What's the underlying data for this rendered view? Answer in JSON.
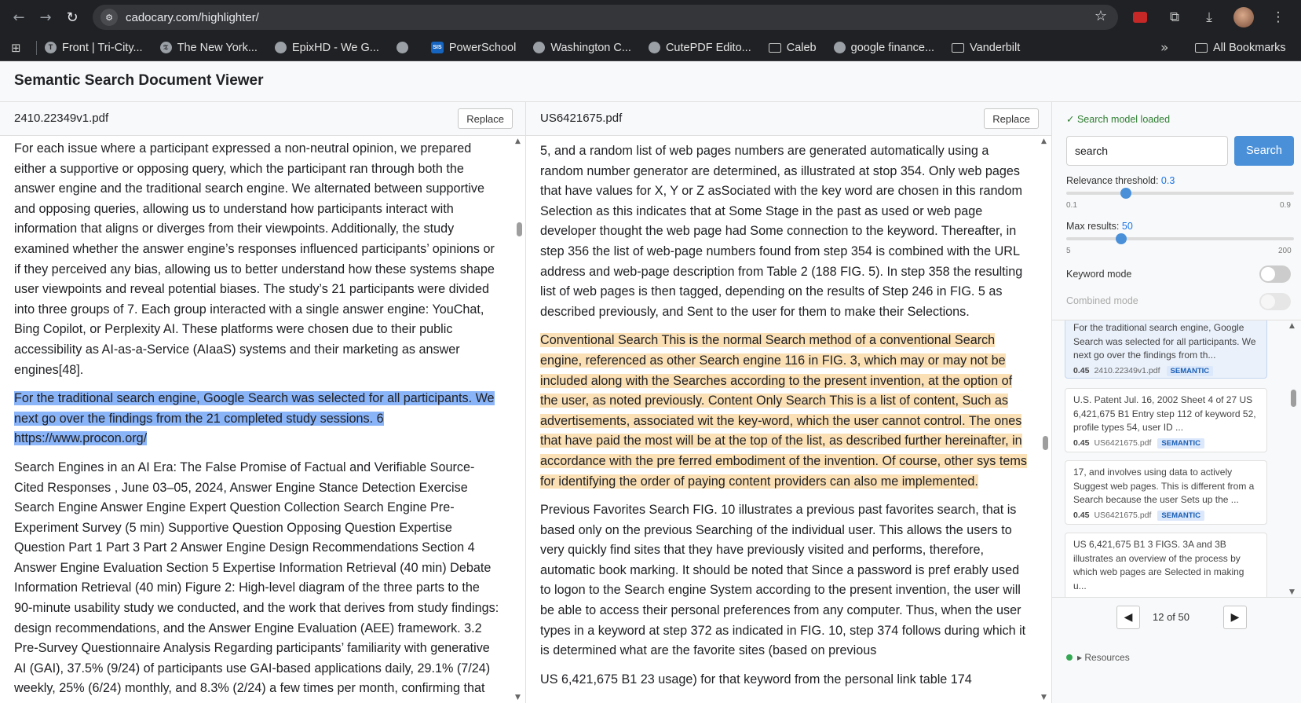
{
  "browser": {
    "url": "cadocary.com/highlighter/",
    "bookmarks": [
      {
        "label": "Front | Tri-City...",
        "icon": "T"
      },
      {
        "label": "The New York...",
        "icon": "NYT"
      },
      {
        "label": "EpixHD - We G...",
        "icon": "globe"
      },
      {
        "label": "",
        "icon": "globe"
      },
      {
        "label": "PowerSchool",
        "icon": "sis"
      },
      {
        "label": "Washington C...",
        "icon": "globe"
      },
      {
        "label": "CutePDF Edito...",
        "icon": "globe"
      },
      {
        "label": "Caleb",
        "icon": "folder"
      },
      {
        "label": "google finance...",
        "icon": "globe"
      },
      {
        "label": "Vanderbilt",
        "icon": "folder"
      }
    ],
    "more_label": "»",
    "all_bookmarks": "All Bookmarks"
  },
  "app": {
    "title": "Semantic Search Document Viewer"
  },
  "left_pane": {
    "filename": "2410.22349v1.pdf",
    "replace_label": "Replace",
    "paragraphs": [
      "For each issue where a participant expressed a non-neutral opinion, we prepared either a supportive or opposing query, which the participant ran through both the answer engine and the traditional search engine. We alternated between supportive and opposing queries, allowing us to understand how participants interact with information that aligns or diverges from their viewpoints. Additionally, the study examined whether the answer engine’s responses influenced participants’ opinions or if they perceived any bias, allowing us to better understand how these systems shape user viewpoints and reveal potential biases. The study’s 21 participants were divided into three groups of 7. Each group interacted with a single answer engine: YouChat, Bing Copilot, or Perplexity AI. These platforms were chosen due to their public accessibility as AI-as-a-Service (AIaaS) systems and their marketing as answer engines[48].",
      " For the traditional search engine, Google Search was selected for all participants. We next go over the findings from the 21 completed study sessions.  6  https://www.procon.org/ ",
      "Search Engines in an AI Era: The False Promise of Factual and Verifiable Source-Cited Responses   , June 03–05, 2024, Answer Engine  Stance Detection Exercise  Search Engine  Answer Engine  Expert Question Collection  Search Engine  Pre-Experiment Survey  (5 min)  Supportive Question Opposing Question Expertise Question  Part 1  Part 3 Part 2  Answer Engine Design Recommendations  Section 4  Answer Engine Evaluation  Section 5  Expertise Information Retrieval  (40 min)  Debate Information Retrieval  (40 min)  Figure 2: High-level diagram of the three parts to the 90-minute usability study we conducted, and the work that derives from study findings: design recommendations, and the Answer Engine Evaluation (AEE) framework.  3.2   Pre-Survey Questionnaire Analysis  Regarding participants’ familiarity with generative AI (GAI), 37.5% (9/24) of participants use GAI-based applications daily, 29.1% (7/24) weekly, 25% (6/24) monthly, and 8.3% (2/24) a few times per month, confirming that"
    ]
  },
  "middle_pane": {
    "filename": "US6421675.pdf",
    "replace_label": "Replace",
    "paragraphs": [
      "5, and a random list of web pages numbers are generated automatically using a random number generator are determined, as illustrated at stop 354. Only web pages that have values for X, Y or Z asSociated with the key word are chosen in this random Selection as this indicates that at Some Stage in the past as used or web page developer thought the web page had Some connection to the keyword. Thereafter, in step 356 the list of web-page numbers found from step 354 is combined with the URL address and web-page description from Table 2 (188 FIG. 5). In step 358 the resulting list of web pages is then tagged, depending on the results of Step 246 in FIG. 5 as described previously, and Sent to the user for them to make their Selections.",
      " Conventional Search This is the normal Search method of a conventional Search engine, referenced as other Search engine 116 in FIG. 3, which may or may not be included along with the Searches according to the present invention, at the option of the user, as noted previously. Content Only Search This is a list of content, Such as advertisements, associated wit the key-word, which the user cannot control. The ones that have paid the most will be at the top of the list, as described further hereinafter, in accordance with the pre ferred embodiment of the invention. Of course, other sys tems for identifying the order of paying content providers can also me implemented. ",
      "Previous Favorites Search FIG. 10 illustrates a previous past favorites search, that is based only on the previous Searching of the individual user. This allows the users to very quickly find sites that they have previously visited and performs, therefore, automatic book marking. It should be noted that Since a password is pref erably used to logon to the Search engine System according to the present invention, the user will be able to access their personal preferences from any computer. Thus, when the user types in a keyword at step 372 as indicated in FIG. 10, step 374 follows during which it is determined what are the favorite sites (based on previous",
      "US 6,421,675 B1 23 usage) for that keyword from the personal link table 174"
    ]
  },
  "sidebar": {
    "status": "✓ Search model loaded",
    "search_value": "search",
    "search_button": "Search",
    "threshold_label": "Relevance threshold:",
    "threshold_value": "0.3",
    "threshold_fraction": 0.25,
    "threshold_min": "0.1",
    "threshold_max": "0.9",
    "max_label": "Max results:",
    "max_value": "50",
    "max_fraction": 0.23,
    "max_min": "5",
    "max_max": "200",
    "keyword_mode": "Keyword mode",
    "combined_mode": "Combined mode",
    "results": [
      {
        "text": "For the traditional search engine, Google Search was selected for all participants. We next go over the findings from th...",
        "score": "0.45",
        "file": "2410.22349v1.pdf",
        "badge": "SEMANTIC"
      },
      {
        "text": "U.S. Patent Jul. 16, 2002 Sheet 4 of 27 US 6,421,675 B1 Entry step 112 of keyword 52, profile types 54, user ID ...",
        "score": "0.45",
        "file": "US6421675.pdf",
        "badge": "SEMANTIC"
      },
      {
        "text": "17, and involves using data to actively Suggest web pages. This is different from a Search because the user Sets up the ...",
        "score": "0.45",
        "file": "US6421675.pdf",
        "badge": "SEMANTIC"
      },
      {
        "text": "US 6,421,675 B1 3 FIGS. 3A and 3B illustrates an overview of the process by which web pages are Selected in making u...",
        "score": "",
        "file": "",
        "badge": ""
      }
    ],
    "pager_text": "12 of 50",
    "resources": "▸ Resources"
  }
}
